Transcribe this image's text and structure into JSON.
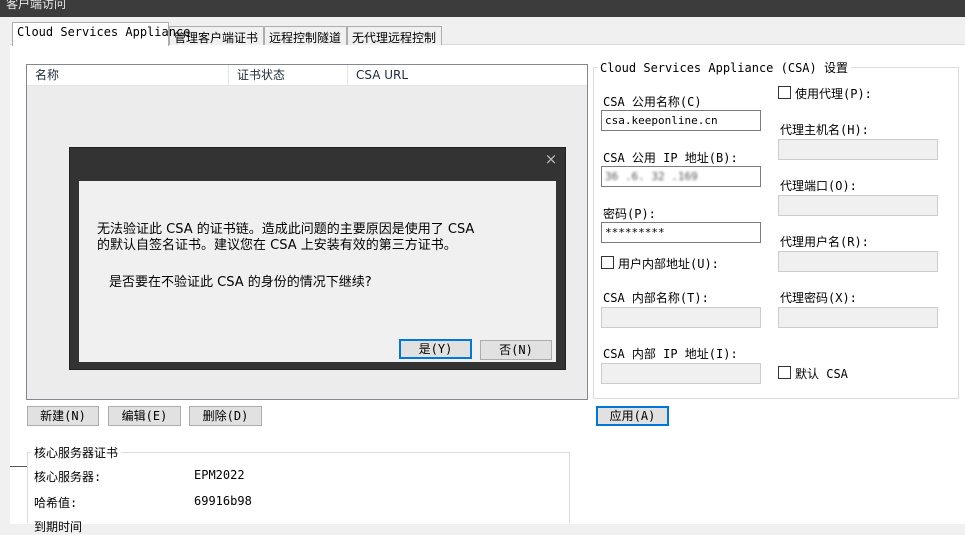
{
  "window": {
    "title": "客户端访问"
  },
  "tabs": [
    {
      "label": "Cloud Services Appliance",
      "active": true
    },
    {
      "label": "管理客户端证书",
      "active": false
    },
    {
      "label": "远程控制隧道",
      "active": false
    },
    {
      "label": "无代理远程控制",
      "active": false
    }
  ],
  "csa_list": {
    "columns": [
      "名称",
      "证书状态",
      "CSA URL"
    ],
    "buttons": {
      "new": "新建(N)",
      "edit": "编辑(E)",
      "delete": "删除(D)"
    }
  },
  "dialog": {
    "close_glyph": "×",
    "message_line1": "无法验证此 CSA 的证书链。造成此问题的主要原因是使用了 CSA",
    "message_line2": "的默认自签名证书。建议您在 CSA 上安装有效的第三方证书。",
    "question": "是否要在不验证此 CSA 的身份的情况下继续?",
    "yes_label": "是(Y)",
    "no_label": "否(N)"
  },
  "csa_settings": {
    "group_title": "Cloud Services Appliance (CSA) 设置",
    "public_name_label": "CSA 公用名称(C)",
    "public_name_value": "csa.keeponline.cn",
    "public_ip_label": "CSA 公用 IP 地址(B):",
    "public_ip_value": "36 .6. 32 .169",
    "password_label": "密码(P):",
    "password_value": "*********",
    "user_internal_label": "用户内部地址(U):",
    "internal_name_label": "CSA 内部名称(T):",
    "internal_ip_label": "CSA 内部 IP 地址(I):",
    "use_proxy_label": "使用代理(P):",
    "proxy_host_label": "代理主机名(H):",
    "proxy_port_label": "代理端口(O):",
    "proxy_user_label": "代理用户名(R):",
    "proxy_password_label": "代理密码(X):",
    "default_csa_label": "默认 CSA",
    "apply_label": "应用(A)"
  },
  "core_cert": {
    "group_title": "核心服务器证书",
    "server_label": "核心服务器:",
    "server_value": "EPM2022",
    "hash_label": "哈希值:",
    "hash_value": "69916b98",
    "truncated_label": "到期时间"
  }
}
